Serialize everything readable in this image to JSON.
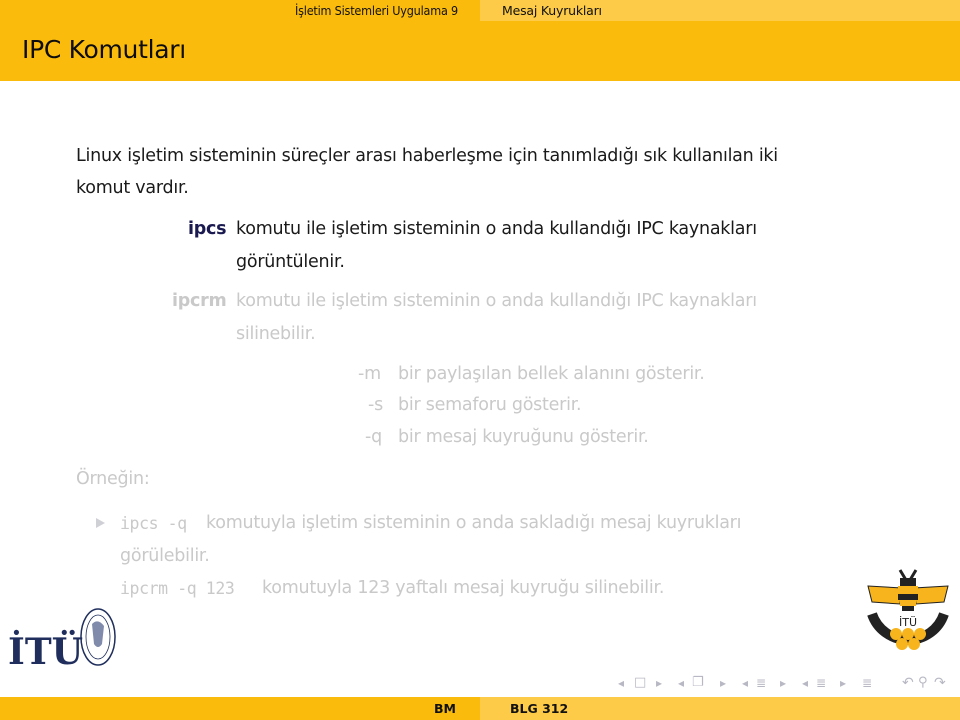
{
  "header": {
    "section": "İşletim Sistemleri Uygulama 9",
    "subsection": "Mesaj Kuyrukları"
  },
  "slide": {
    "title": "IPC Komutları",
    "intro_line1": "Linux işletim sisteminin süreçler arası haberleşme için tanımladığı sık kullanılan iki",
    "intro_line2": "komut vardır.",
    "commands": [
      {
        "name": "ipcs",
        "desc_line1": "komutu ile işletim sisteminin o anda kullandığı IPC kaynakları",
        "desc_line2": "görüntülenir.",
        "state": "active"
      },
      {
        "name": "ipcrm",
        "desc_line1": "komutu ile işletim sisteminin o anda kullandığı IPC kaynakları",
        "desc_line2": "silinebilir.",
        "state": "faded"
      }
    ],
    "options": [
      {
        "flag": "-m",
        "desc": "bir paylaşılan bellek alanını gösterir."
      },
      {
        "flag": "-s",
        "desc": "bir semaforu gösterir."
      },
      {
        "flag": "-q",
        "desc": "bir mesaj kuyruğunu gösterir."
      }
    ],
    "example_label": "Örneğin:",
    "examples": {
      "item1_code": "ipcs -q",
      "item1_text": "komutuyla işletim sisteminin o anda sakladığı mesaj kuyrukları",
      "item1_text2": "görülebilir.",
      "item2_code": "ipcrm -q 123",
      "item2_text": "komutuyla 123 yaftalı mesaj kuyruğu silinebilir."
    }
  },
  "logos": {
    "left": "ITU logo with seal",
    "left_text": "İTÜ",
    "right": "Bilgisayar ve Bilişim Fakültesi bee logo",
    "right_text": "İTÜ",
    "right_ring_text": "Bilgisayar ve Bilişim Fakültesi"
  },
  "navigation": {
    "icons": [
      "arrow-left",
      "frame",
      "arrow-right",
      "arrow-left",
      "subsection",
      "arrow-right",
      "arrow-left",
      "section",
      "arrow-right",
      "arrow-left",
      "doc",
      "arrow-right",
      "appendix",
      "back",
      "search",
      "forward"
    ]
  },
  "colors": {
    "accent_dark": "#fbbb0c",
    "accent_light": "#fdcb47",
    "label_active": "#1a1a50",
    "faded_text": "#c9c9c9"
  },
  "footer": {
    "institute": "BM",
    "course": "BLG 312"
  }
}
